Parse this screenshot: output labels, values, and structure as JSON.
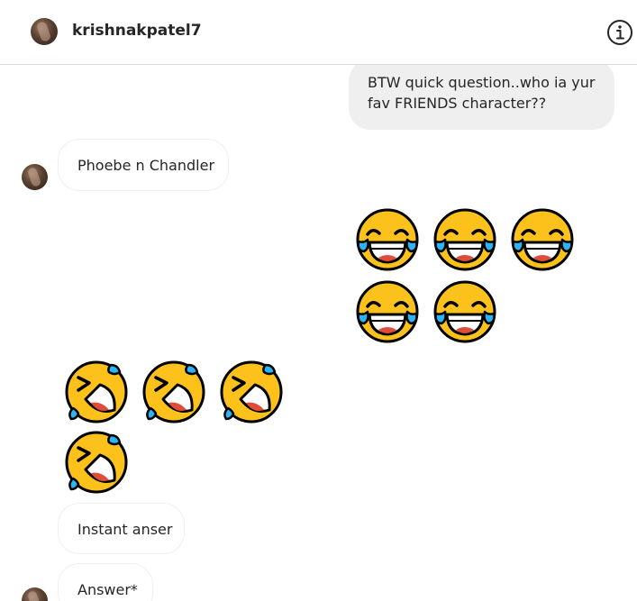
{
  "header": {
    "username": "krishnakpatel7",
    "avatar_icon": "profile-avatar",
    "info_icon": "info-icon"
  },
  "messages": [
    {
      "direction": "outgoing",
      "lines": [
        "BTW quick question..who ia yur",
        "fav FRIENDS character??"
      ]
    },
    {
      "direction": "incoming",
      "text": "Phoebe n Chandler"
    },
    {
      "direction": "outgoing",
      "emoji": "face-with-tears-of-joy",
      "count": 5
    },
    {
      "direction": "incoming",
      "emoji": "rolling-on-the-floor-laughing",
      "count": 4
    },
    {
      "direction": "incoming",
      "text": "Instant anser"
    },
    {
      "direction": "incoming",
      "text": "Answer*"
    }
  ],
  "colors": {
    "outgoing_bubble": "#efefef",
    "incoming_border": "#efefef",
    "divider": "#dbdbdb",
    "emoji_yellow": "#fcc21b",
    "emoji_tear": "#29b6f6"
  }
}
